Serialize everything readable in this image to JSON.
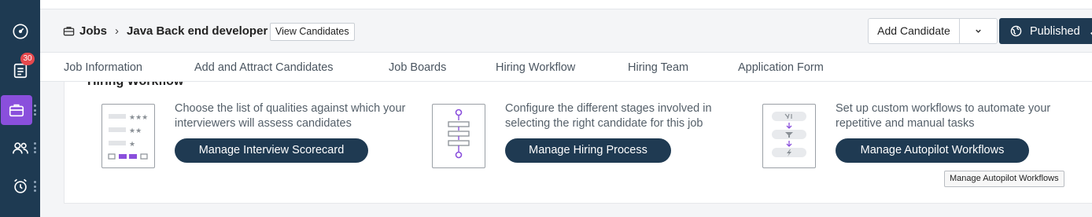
{
  "rail": {
    "notification_count": "30",
    "items": [
      {
        "icon": "dashboard-icon"
      },
      {
        "icon": "tasks-icon"
      },
      {
        "icon": "jobs-briefcase-icon"
      },
      {
        "icon": "candidates-icon"
      },
      {
        "icon": "alarm-clock-icon"
      }
    ],
    "active_color": "#8a4fdc",
    "bg_color": "#1e3a52"
  },
  "header": {
    "breadcrumb_root": "Jobs",
    "breadcrumb_separator": "›",
    "job_title": "Java Back end developer",
    "view_candidates": "View Candidates",
    "add_candidate": "Add Candidate",
    "status_button": "Published"
  },
  "tabs": [
    "Job Information",
    "Add and Attract Candidates",
    "Job Boards",
    "Hiring Workflow",
    "Hiring Team",
    "Application Form"
  ],
  "section": {
    "title": "Hiring Workflow",
    "cards": [
      {
        "description_line1": "Choose the list of qualities against which your",
        "description_line2": "interviewers will assess candidates",
        "button": "Manage Interview Scorecard",
        "icon": "scorecard-icon"
      },
      {
        "description_line1": "Configure the different stages involved in",
        "description_line2": "selecting the right candidate for this job",
        "button": "Manage Hiring Process",
        "icon": "process-stages-icon"
      },
      {
        "description_line1": "Set up custom workflows to automate your",
        "description_line2": "repetitive and manual tasks",
        "button": "Manage Autopilot Workflows",
        "icon": "autopilot-icon"
      }
    ]
  },
  "tooltip": "Manage Autopilot Workflows",
  "colors": {
    "primary": "#1f3a52",
    "accent": "#8a4fdc",
    "badge": "#e5484d"
  }
}
